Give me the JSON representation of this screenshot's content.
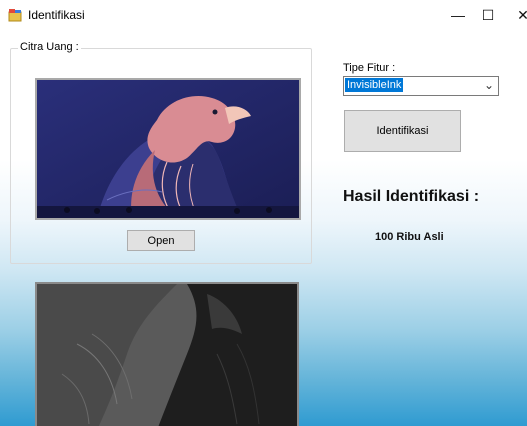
{
  "window": {
    "title": "Identifikasi",
    "minimize_label": "—",
    "maximize_label": "☐",
    "close_label": "✕"
  },
  "group": {
    "label": "Citra Uang :"
  },
  "images": {
    "original_icon": "eagle-image",
    "processed_icon": "eagle-grayscale-image"
  },
  "buttons": {
    "open_label": "Open",
    "identify_label": "Identifikasi"
  },
  "fitur": {
    "label": "Tipe Fitur :",
    "selected": "InvisibleInk"
  },
  "result": {
    "heading": "Hasil Identifikasi :",
    "value": "100 Ribu Asli"
  }
}
